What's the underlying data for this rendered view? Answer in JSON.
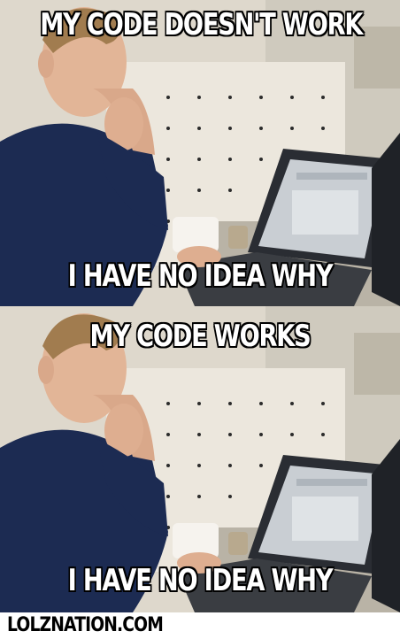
{
  "meme": {
    "top_panel": {
      "caption_top": "MY CODE DOESN'T WORK",
      "caption_bottom": "I HAVE NO IDEA WHY"
    },
    "bottom_panel": {
      "caption_top": "MY CODE WORKS",
      "caption_bottom": "I HAVE NO IDEA WHY"
    }
  },
  "footer": {
    "watermark": "LOLZNATION.COM"
  },
  "colors": {
    "caption_fill": "#ffffff",
    "caption_outline": "#000000",
    "sweater": "#1c2b52",
    "wall": "#e9e3d8"
  }
}
